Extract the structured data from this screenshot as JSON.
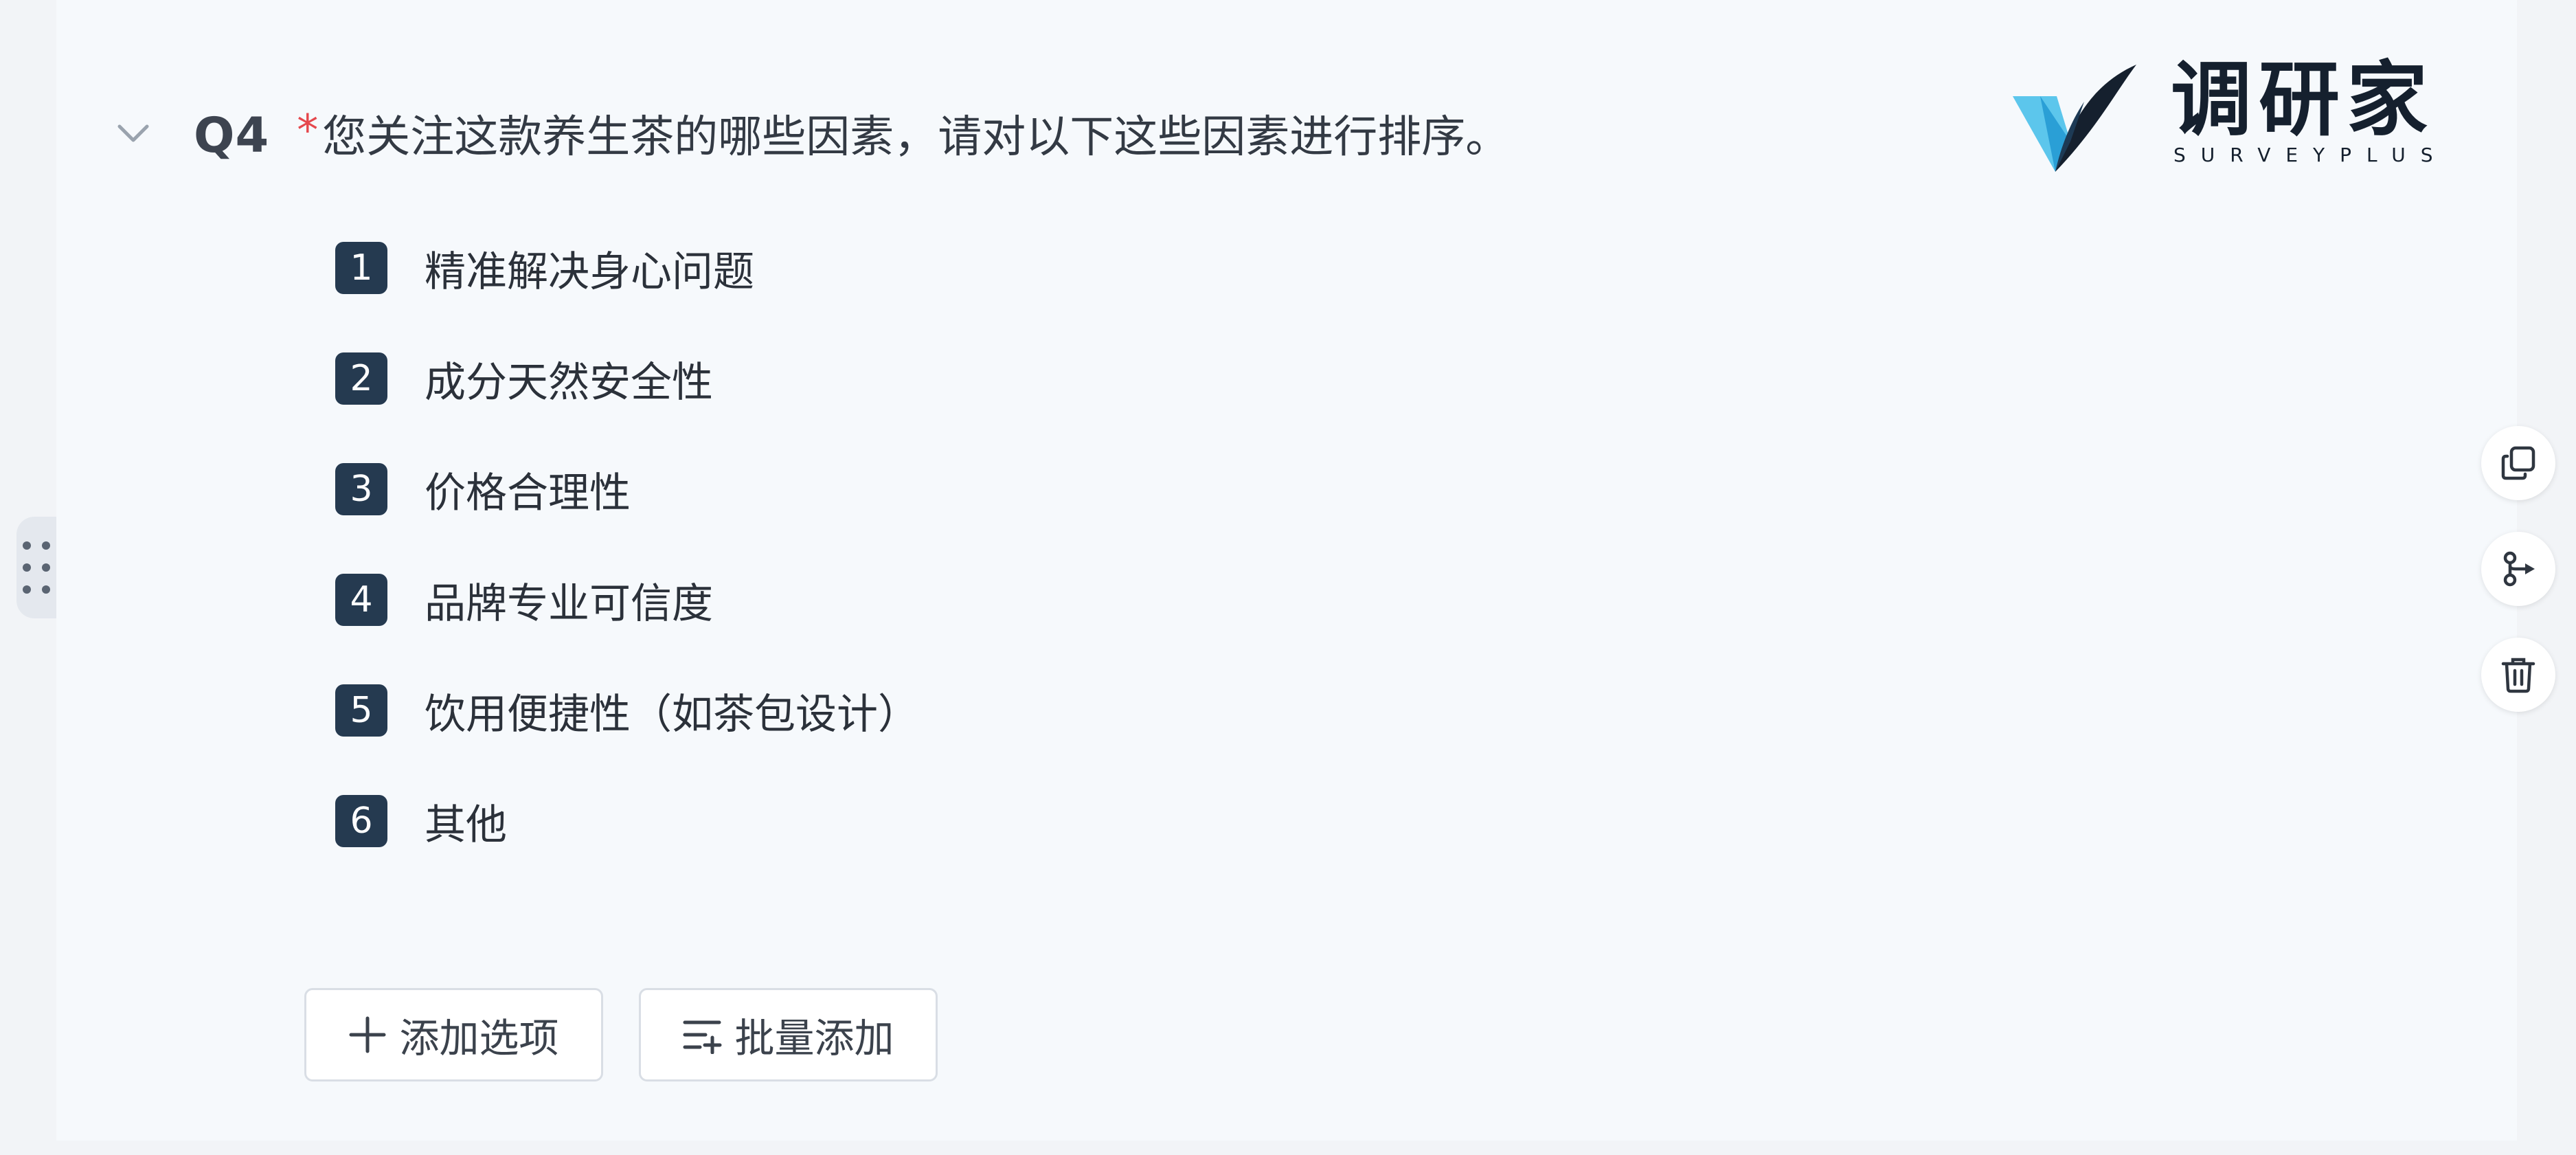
{
  "question": {
    "number": "Q4",
    "required_mark": "*",
    "title": "您关注这款养生茶的哪些因素，请对以下这些因素进行排序。",
    "options": [
      {
        "rank": "1",
        "label": "精准解决身心问题"
      },
      {
        "rank": "2",
        "label": "成分天然安全性"
      },
      {
        "rank": "3",
        "label": "价格合理性"
      },
      {
        "rank": "4",
        "label": "品牌专业可信度"
      },
      {
        "rank": "5",
        "label": "饮用便捷性（如茶包设计）"
      },
      {
        "rank": "6",
        "label": "其他"
      }
    ]
  },
  "actions": {
    "add_option_label": "添加选项",
    "batch_add_label": "批量添加"
  },
  "logo": {
    "cn": "调研家",
    "en": "SURVEYPLUS"
  },
  "side_tools": [
    "copy-icon",
    "branch-logic-icon",
    "delete-icon"
  ],
  "icons": {
    "collapse": "chevron-down-icon",
    "drag": "drag-handle-icon",
    "add": "plus-icon",
    "batch": "batch-list-icon"
  },
  "colors": {
    "badge": "#253a50",
    "required": "#e5484d",
    "card_bg": "#f6f9fc"
  }
}
